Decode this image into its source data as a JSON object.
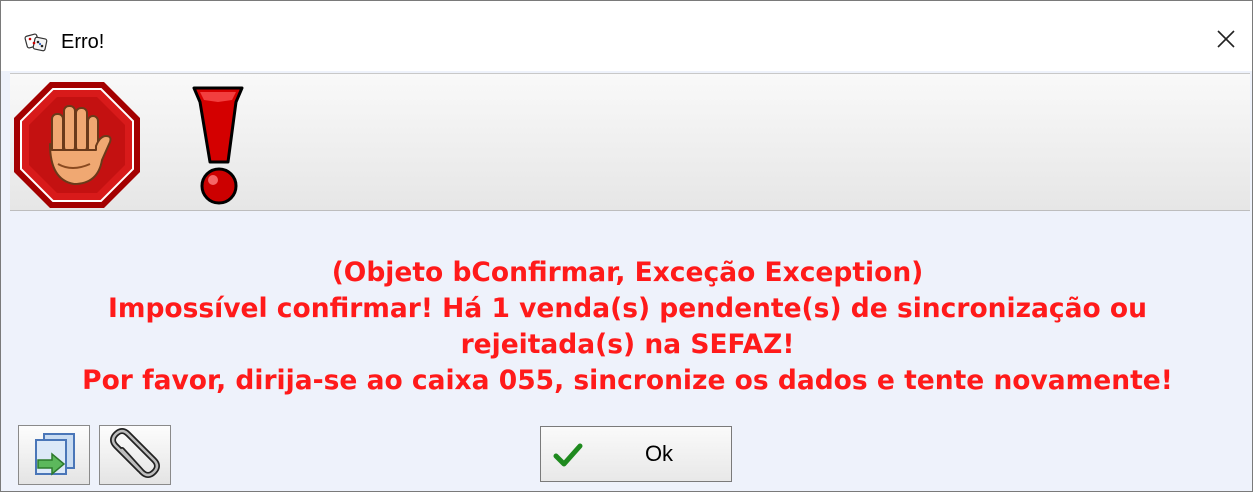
{
  "window": {
    "title": "Erro!",
    "app_icon": "dice-app-icon",
    "close_icon": "close-icon"
  },
  "banner": {
    "stop_icon": "stop-hand-icon",
    "exclamation_icon": "exclamation-icon"
  },
  "message": {
    "lines": [
      "(Objeto bConfirmar, Exceção Exception)",
      "Impossível confirmar! Há 1 venda(s) pendente(s) de sincronização ou",
      "rejeitada(s) na SEFAZ!",
      "Por favor, dirija-se ao caixa 055, sincronize os dados e tente novamente!"
    ],
    "color": "#ff1a1a"
  },
  "buttons": {
    "export_icon": "export-document-icon",
    "attach_icon": "paperclip-icon",
    "ok_label": "Ok",
    "ok_icon": "checkmark-icon"
  }
}
